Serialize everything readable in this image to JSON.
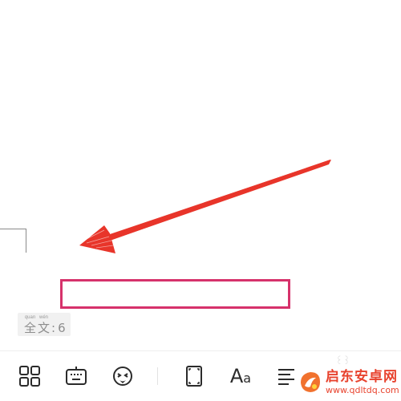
{
  "document": {
    "word_count": {
      "label_chars": [
        {
          "pinyin": "quan",
          "hanzi": "全"
        },
        {
          "pinyin": "wén",
          "hanzi": "文"
        }
      ],
      "separator": ":",
      "value": "6"
    }
  },
  "annotation": {
    "arrow_color": "#e8352a",
    "highlight_color": "#d6326b"
  },
  "toolbar": {
    "items": [
      {
        "name": "grid-icon"
      },
      {
        "name": "keyboard-icon"
      },
      {
        "name": "emoji-icon"
      },
      {
        "name": "page-frame-icon"
      },
      {
        "name": "font-style-icon",
        "label_big": "A",
        "label_small": "a"
      },
      {
        "name": "align-left-icon"
      }
    ],
    "faint_mark": "꒰꒱"
  },
  "watermark": {
    "title": "启东安卓网",
    "url": "www.qdltdq.com",
    "color": "#e8432e"
  }
}
